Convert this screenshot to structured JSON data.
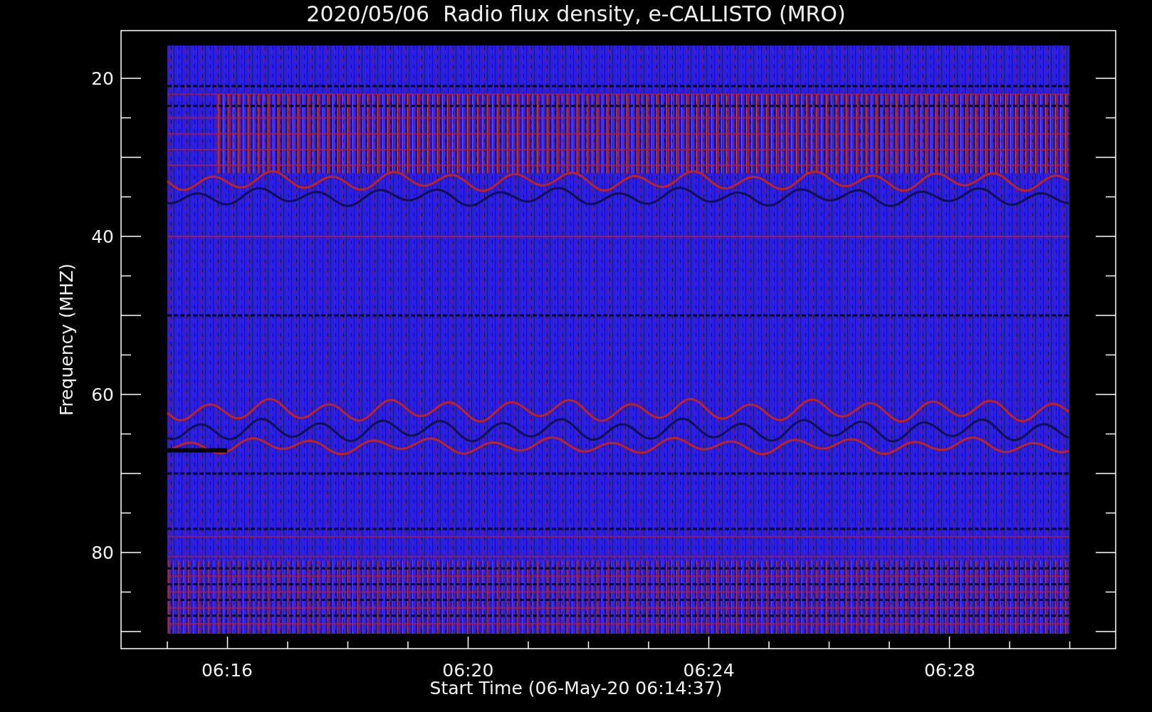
{
  "title": "2020/05/06  Radio flux density, e-CALLISTO (MRO)",
  "y_axis": {
    "label": "Frequency (MHZ)",
    "ticks": [
      "20",
      "40",
      "60",
      "80"
    ]
  },
  "x_axis": {
    "label": "Start Time (06-May-20 06:14:37)",
    "ticks": [
      "06:16",
      "06:20",
      "06:24",
      "06:28"
    ]
  }
}
